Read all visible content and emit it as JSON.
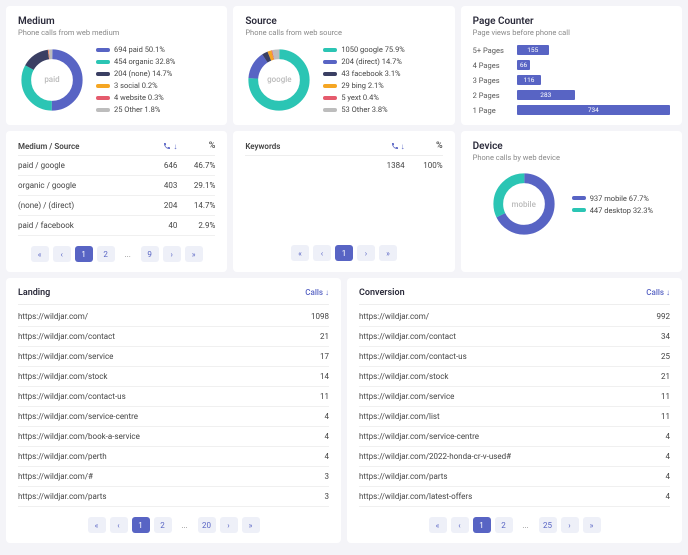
{
  "medium": {
    "title": "Medium",
    "sub": "Phone calls from web medium",
    "center": "paid",
    "legend": [
      {
        "color": "#5864c4",
        "label": "694 paid 50.1%"
      },
      {
        "color": "#2bc5b4",
        "label": "454 organic 32.8%"
      },
      {
        "color": "#3a3f63",
        "label": "204 (none) 14.7%"
      },
      {
        "color": "#f5a623",
        "label": "3 social 0.2%"
      },
      {
        "color": "#e55b6d",
        "label": "4 website 0.3%"
      },
      {
        "color": "#bdbdbd",
        "label": "25 Other 1.8%"
      }
    ]
  },
  "source": {
    "title": "Source",
    "sub": "Phone calls from web source",
    "center": "google",
    "legend": [
      {
        "color": "#2bc5b4",
        "label": "1050 google 75.9%"
      },
      {
        "color": "#5864c4",
        "label": "204 (direct) 14.7%"
      },
      {
        "color": "#3a3f63",
        "label": "43 facebook 3.1%"
      },
      {
        "color": "#f5a623",
        "label": "29 bing 2.1%"
      },
      {
        "color": "#e55b6d",
        "label": "5 yext 0.4%"
      },
      {
        "color": "#bdbdbd",
        "label": "53 Other 3.8%"
      }
    ]
  },
  "pagecounter": {
    "title": "Page Counter",
    "sub": "Page views before phone call"
  },
  "device": {
    "title": "Device",
    "sub": "Phone calls by web device",
    "center": "mobile",
    "legend": [
      {
        "color": "#5864c4",
        "label": "937 mobile 67.7%"
      },
      {
        "color": "#2bc5b4",
        "label": "447 desktop 32.3%"
      }
    ]
  },
  "ms_table": {
    "title": "Medium / Source",
    "rows": [
      {
        "name": "paid / google",
        "calls": "646",
        "pct": "46.7%"
      },
      {
        "name": "organic / google",
        "calls": "403",
        "pct": "29.1%"
      },
      {
        "name": "(none) / (direct)",
        "calls": "204",
        "pct": "14.7%"
      },
      {
        "name": "paid / facebook",
        "calls": "40",
        "pct": "2.9%"
      }
    ]
  },
  "kw_table": {
    "title": "Keywords",
    "rows": [
      {
        "name": "",
        "calls": "1384",
        "pct": "100%"
      }
    ]
  },
  "landing": {
    "title": "Landing",
    "sort": "Calls ↓",
    "rows": [
      {
        "url": "https://wildjar.com/",
        "n": "1098"
      },
      {
        "url": "https://wildjar.com/contact",
        "n": "21"
      },
      {
        "url": "https://wildjar.com/service",
        "n": "17"
      },
      {
        "url": "https://wildjar.com/stock",
        "n": "14"
      },
      {
        "url": "https://wildjar.com/contact-us",
        "n": "11"
      },
      {
        "url": "https://wildjar.com/service-centre",
        "n": "4"
      },
      {
        "url": "https://wildjar.com/book-a-service",
        "n": "4"
      },
      {
        "url": "https://wildjar.com/perth",
        "n": "4"
      },
      {
        "url": "https://wildjar.com/#",
        "n": "3"
      },
      {
        "url": "https://wildjar.com/parts",
        "n": "3"
      }
    ]
  },
  "conversion": {
    "title": "Conversion",
    "sort": "Calls ↓",
    "rows": [
      {
        "url": "https://wildjar.com/",
        "n": "992"
      },
      {
        "url": "https://wildjar.com/contact",
        "n": "34"
      },
      {
        "url": "https://wildjar.com/contact-us",
        "n": "25"
      },
      {
        "url": "https://wildjar.com/stock",
        "n": "21"
      },
      {
        "url": "https://wildjar.com/service",
        "n": "11"
      },
      {
        "url": "https://wildjar.com/list",
        "n": "11"
      },
      {
        "url": "https://wildjar.com/service-centre",
        "n": "4"
      },
      {
        "url": "https://wildjar.com/2022-honda-cr-v-used#",
        "n": "4"
      },
      {
        "url": "https://wildjar.com/parts",
        "n": "4"
      },
      {
        "url": "https://wildjar.com/latest-offers",
        "n": "4"
      }
    ]
  },
  "pager_first": "«",
  "pager_prev": "‹",
  "pager_next": "›",
  "pager_last": "»",
  "pager_1": "1",
  "pager_2": "2",
  "pager_dots": "...",
  "pager_9": "9",
  "pager_20": "20",
  "pager_25": "25",
  "arrow_down": "↓",
  "chart_data": [
    {
      "type": "pie",
      "title": "Medium",
      "categories": [
        "paid",
        "organic",
        "(none)",
        "social",
        "website",
        "Other"
      ],
      "values": [
        694,
        454,
        204,
        3,
        4,
        25
      ],
      "pct": [
        50.1,
        32.8,
        14.7,
        0.2,
        0.3,
        1.8
      ]
    },
    {
      "type": "pie",
      "title": "Source",
      "categories": [
        "google",
        "(direct)",
        "facebook",
        "bing",
        "yext",
        "Other"
      ],
      "values": [
        1050,
        204,
        43,
        29,
        5,
        53
      ],
      "pct": [
        75.9,
        14.7,
        3.1,
        2.1,
        0.4,
        3.8
      ]
    },
    {
      "type": "bar",
      "title": "Page Counter",
      "categories": [
        "5+ Pages",
        "4 Pages",
        "3 Pages",
        "2 Pages",
        "1 Page"
      ],
      "values": [
        155,
        66,
        116,
        283,
        734
      ],
      "xlim": [
        0,
        800
      ]
    },
    {
      "type": "pie",
      "title": "Device",
      "categories": [
        "mobile",
        "desktop"
      ],
      "values": [
        937,
        447
      ],
      "pct": [
        67.7,
        32.3
      ]
    }
  ]
}
